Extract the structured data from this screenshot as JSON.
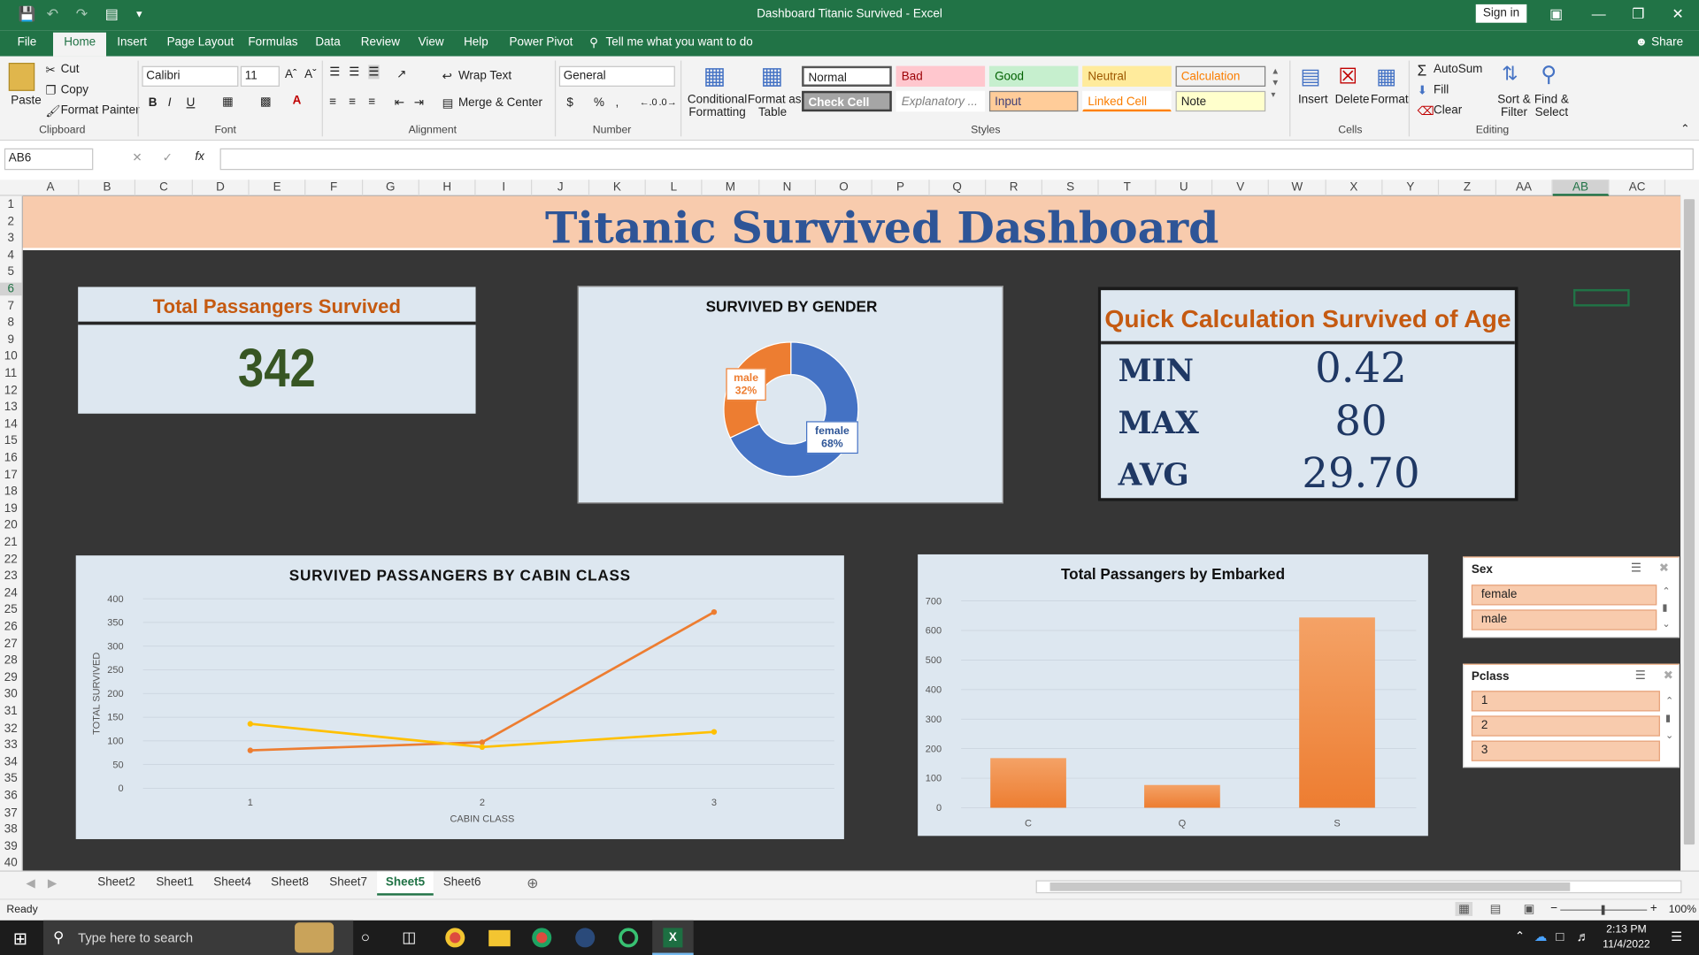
{
  "window": {
    "title": "Dashboard Titanic Survived  -  Excel",
    "sign_in": "Sign in",
    "share": "Share"
  },
  "menu": {
    "tabs": [
      "File",
      "Home",
      "Insert",
      "Page Layout",
      "Formulas",
      "Data",
      "Review",
      "View",
      "Help",
      "Power Pivot"
    ],
    "tell_me": "Tell me what you want to do"
  },
  "ribbon": {
    "clipboard": {
      "paste": "Paste",
      "cut": "Cut",
      "copy": "Copy",
      "format_painter": "Format Painter",
      "label": "Clipboard"
    },
    "font": {
      "name": "Calibri",
      "size": "11",
      "label": "Font"
    },
    "alignment": {
      "wrap": "Wrap Text",
      "merge": "Merge & Center",
      "label": "Alignment"
    },
    "number": {
      "format": "General",
      "label": "Number"
    },
    "styles": {
      "conditional": [
        "Conditional",
        "Formatting"
      ],
      "format_table": [
        "Format as",
        "Table"
      ],
      "cells": [
        "Normal",
        "Bad",
        "Good",
        "Neutral",
        "Calculation",
        "Check Cell",
        "Explanatory ...",
        "Input",
        "Linked Cell",
        "Note"
      ],
      "label": "Styles"
    },
    "cells": {
      "insert": "Insert",
      "delete": "Delete",
      "format": "Format",
      "label": "Cells"
    },
    "editing": {
      "autosum": "AutoSum",
      "fill": "Fill",
      "clear": "Clear",
      "sort": [
        "Sort &",
        "Filter"
      ],
      "find": [
        "Find &",
        "Select"
      ],
      "label": "Editing"
    }
  },
  "formula_bar": {
    "name_box": "AB6",
    "fx": "fx",
    "content": ""
  },
  "columns": [
    "A",
    "B",
    "C",
    "D",
    "E",
    "F",
    "G",
    "H",
    "I",
    "J",
    "K",
    "L",
    "M",
    "N",
    "O",
    "P",
    "Q",
    "R",
    "S",
    "T",
    "U",
    "V",
    "W",
    "X",
    "Y",
    "Z",
    "AA",
    "AB",
    "AC"
  ],
  "rows": [
    "1",
    "2",
    "3",
    "4",
    "5",
    "6",
    "7",
    "8",
    "9",
    "10",
    "11",
    "12",
    "13",
    "14",
    "15",
    "16",
    "17",
    "18",
    "19",
    "20",
    "21",
    "22",
    "23",
    "24",
    "25",
    "26",
    "27",
    "28",
    "29",
    "30",
    "31",
    "32",
    "33",
    "34",
    "35",
    "36",
    "37",
    "38",
    "39",
    "40"
  ],
  "dashboard": {
    "title": "Titanic Survived Dashboard",
    "kpi": {
      "title": "Total Passangers Survived",
      "value": "342"
    },
    "gender": {
      "title": "SURVIVED BY GENDER",
      "male_label": "male",
      "male_pct": "32%",
      "female_label": "female",
      "female_pct": "68%"
    },
    "age": {
      "title": "Quick Calculation Survived of Age",
      "rows": [
        {
          "label": "MIN",
          "value": "0.42"
        },
        {
          "label": "MAX",
          "value": "80"
        },
        {
          "label": "AVG",
          "value": "29.70"
        }
      ]
    },
    "slicers": {
      "sex": {
        "title": "Sex",
        "items": [
          "female",
          "male"
        ]
      },
      "pclass": {
        "title": "Pclass",
        "items": [
          "1",
          "2",
          "3"
        ]
      }
    }
  },
  "chart_data": [
    {
      "type": "pie",
      "title": "SURVIVED BY GENDER",
      "categories": [
        "male",
        "female"
      ],
      "values": [
        32,
        68
      ],
      "colors": [
        "#ed7d31",
        "#4472c4"
      ]
    },
    {
      "type": "line",
      "title": "SURVIVED PASSANGERS BY CABIN CLASS",
      "xlabel": "CABIN CLASS",
      "ylabel": "TOTAL SURVIVED",
      "categories": [
        "1",
        "2",
        "3"
      ],
      "ylim": [
        0,
        400
      ],
      "yticks": [
        0,
        50,
        100,
        150,
        200,
        250,
        300,
        350,
        400
      ],
      "series": [
        {
          "values": [
            80,
            97,
            372
          ],
          "color": "#ed7d31"
        },
        {
          "values": [
            136,
            87,
            119
          ],
          "color": "#ffc000"
        }
      ]
    },
    {
      "type": "bar",
      "title": "Total Passangers by Embarked",
      "categories": [
        "C",
        "Q",
        "S"
      ],
      "values": [
        168,
        77,
        644
      ],
      "ylim": [
        0,
        700
      ],
      "yticks": [
        0,
        100,
        200,
        300,
        400,
        500,
        600,
        700
      ],
      "color": "#ed7d31"
    }
  ],
  "sheet_tabs": [
    "Sheet2",
    "Sheet1",
    "Sheet4",
    "Sheet8",
    "Sheet7",
    "Sheet5",
    "Sheet6"
  ],
  "active_sheet": "Sheet5",
  "status": {
    "text": "Ready",
    "zoom": "100%"
  },
  "taskbar": {
    "search": "Type here to search",
    "time": "2:13 PM",
    "date": "11/4/2022"
  }
}
